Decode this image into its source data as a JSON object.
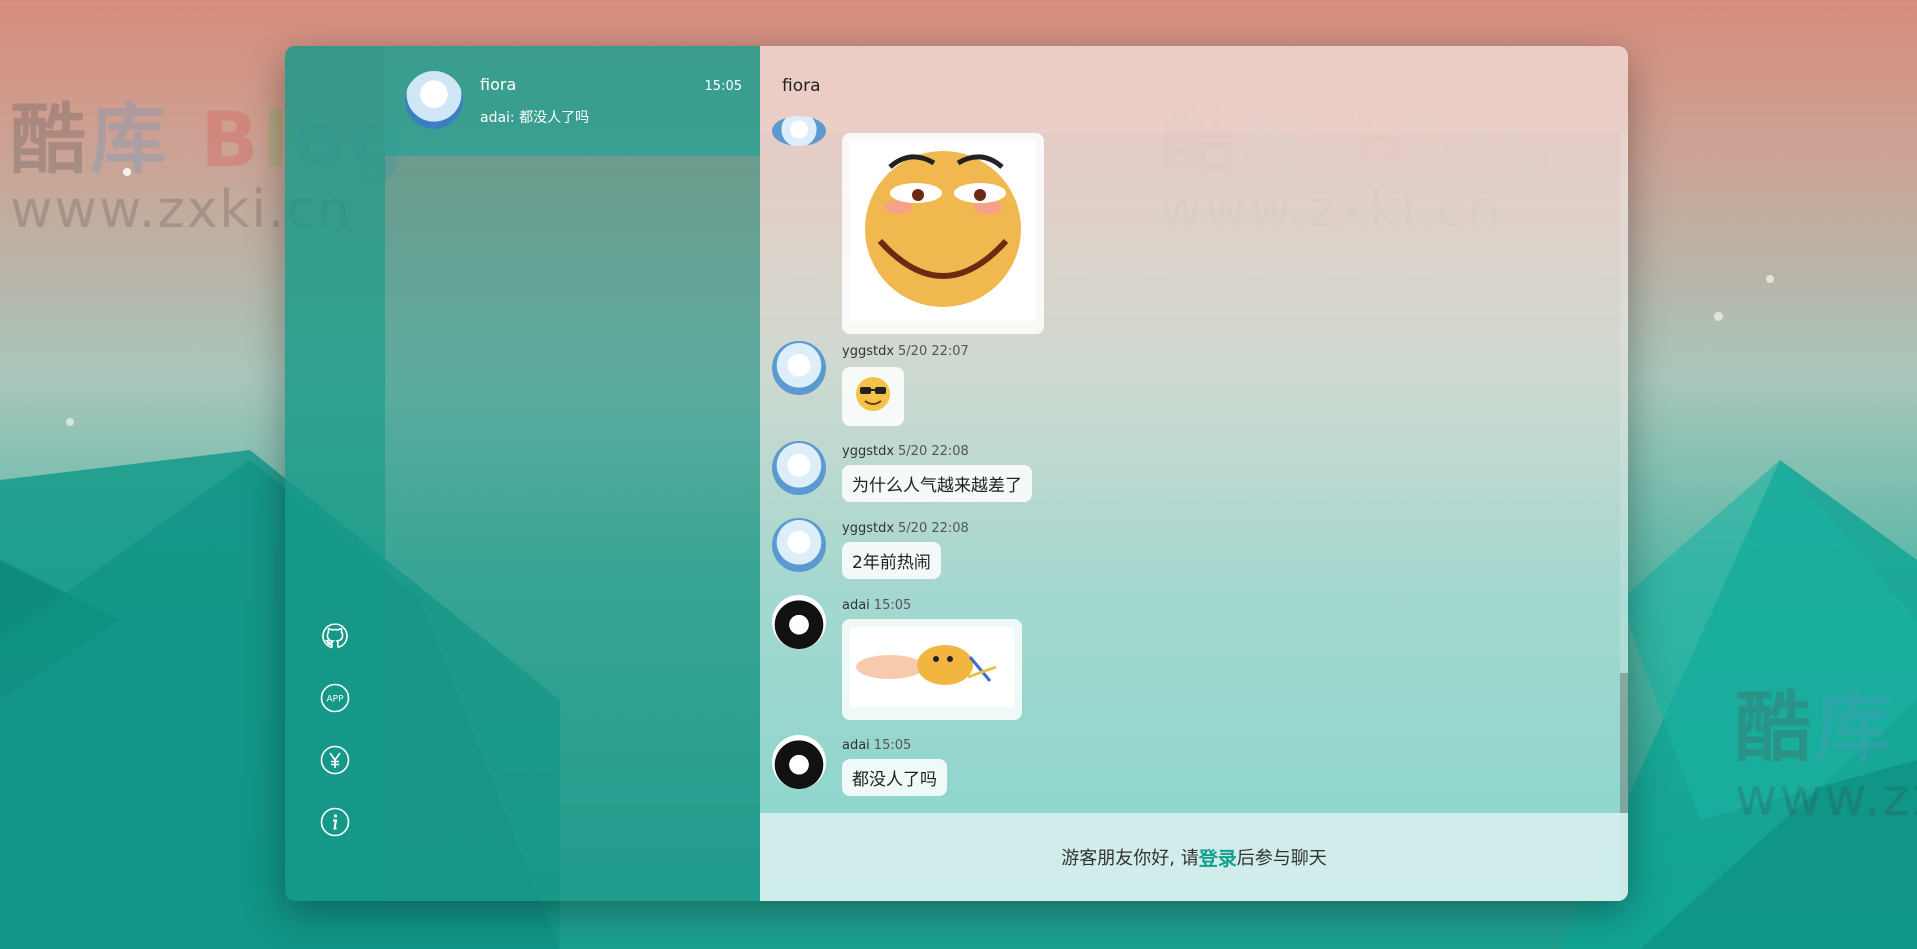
{
  "watermark": {
    "brand_cn_1": "酷",
    "brand_cn_2": "库",
    "brand_b": "B",
    "brand_l": "l",
    "brand_og": "og",
    "url": "www.zxki.cn"
  },
  "sidebar": {
    "icons": [
      "github-icon",
      "app-icon",
      "yen-icon",
      "info-icon"
    ],
    "app_label": "APP"
  },
  "conversation": {
    "name": "fiora",
    "time": "15:05",
    "preview": "adai: 都没人了吗"
  },
  "chat": {
    "title": "fiora",
    "messages": [
      {
        "user": "yggstdx",
        "time": "5/20 22:07",
        "kind": "sticker",
        "sticker": "sunglasses-emoji-icon"
      },
      {
        "user": "yggstdx",
        "time": "5/20 22:08",
        "kind": "text",
        "text": "为什么人气越来越差了"
      },
      {
        "user": "yggstdx",
        "time": "5/20 22:08",
        "kind": "text",
        "text": "2年前热闹"
      },
      {
        "user": "adai",
        "time": "15:05",
        "kind": "image",
        "image": "flying-cat-sticker"
      },
      {
        "user": "adai",
        "time": "15:05",
        "kind": "text",
        "text": "都没人了吗"
      }
    ]
  },
  "footer": {
    "prefix": "游客朋友你好, 请",
    "login": "登录",
    "suffix": "后参与聊天"
  },
  "colors": {
    "accent": "#13a08e",
    "sidebar": "#169888"
  }
}
